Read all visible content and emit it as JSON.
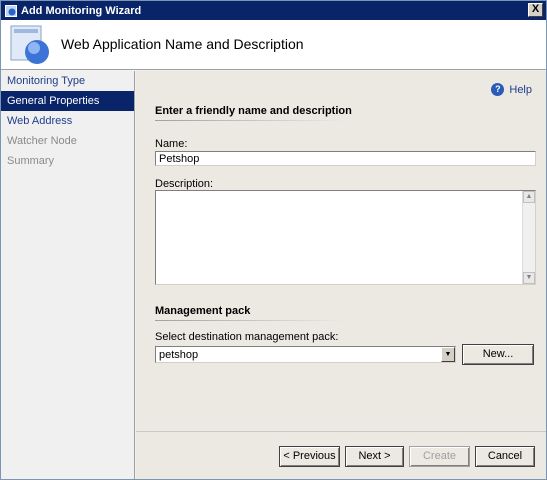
{
  "window": {
    "title": "Add Monitoring Wizard",
    "close_glyph": "X"
  },
  "header": {
    "title": "Web Application Name and Description",
    "icon": "monitor-globe-icon"
  },
  "sidebar": {
    "items": [
      {
        "label": "Monitoring Type",
        "state": "link"
      },
      {
        "label": "General Properties",
        "state": "active"
      },
      {
        "label": "Web Address",
        "state": "link"
      },
      {
        "label": "Watcher Node",
        "state": "disabled"
      },
      {
        "label": "Summary",
        "state": "disabled"
      }
    ]
  },
  "main": {
    "help_label": "Help",
    "help_glyph": "?",
    "section1_title": "Enter a friendly name and description",
    "name_label": "Name:",
    "name_value": "Petshop",
    "description_label": "Description:",
    "description_value": "",
    "section2_title": "Management pack",
    "mp_label": "Select destination management pack:",
    "mp_value": "petshop",
    "new_button": "New..."
  },
  "footer": {
    "previous": "< Previous",
    "next": "Next >",
    "create": "Create",
    "cancel": "Cancel"
  },
  "colors": {
    "titlebar": "#0a246a",
    "selected_nav": "#0a246a",
    "link": "#1f3d8c"
  }
}
